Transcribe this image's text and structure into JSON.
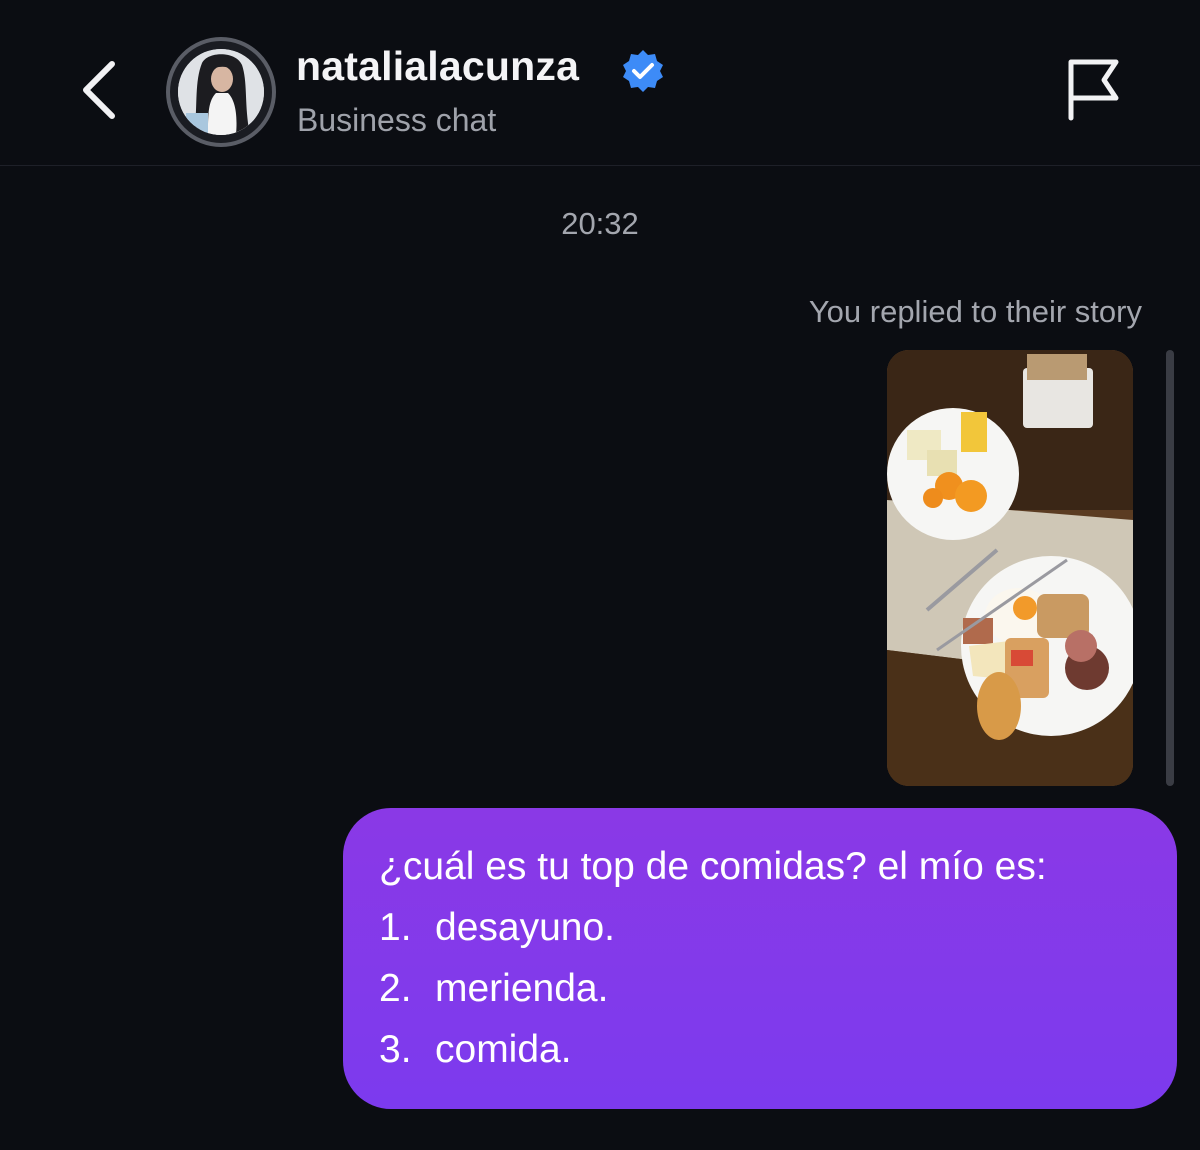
{
  "header": {
    "username": "natalialacunza",
    "subtitle": "Business chat",
    "back_icon": "chevron-left-icon",
    "verified_icon": "verified-badge-icon",
    "flag_icon": "flag-icon",
    "verified_color": "#3d8bf7"
  },
  "thread": {
    "timestamp": "20:32",
    "replied_label": "You replied to their story",
    "message": {
      "intro": "¿cuál es tu top de comidas? el mío es:",
      "items": [
        {
          "num": "1.",
          "text": "desayuno."
        },
        {
          "num": "2.",
          "text": "merienda."
        },
        {
          "num": "3.",
          "text": "comida."
        }
      ],
      "bubble_color": "#8138ea"
    }
  }
}
